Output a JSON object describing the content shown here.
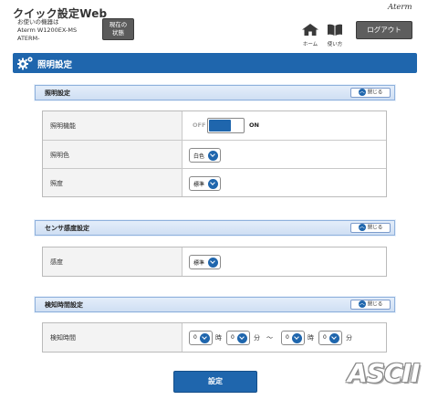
{
  "header": {
    "app_title": "クイック設定Web",
    "device_line1": "お使いの機器は",
    "device_line2": "Aterm W1200EX-MS",
    "device_line3": "ATERM-",
    "status_button_line1": "現在の",
    "status_button_line2": "状態",
    "brand": "Aterm",
    "home_label": "ホーム",
    "manual_label": "使い方",
    "logout_label": "ログアウト"
  },
  "page": {
    "title": "照明設定",
    "icon": "gear-icon"
  },
  "sections": [
    {
      "title": "照明設定",
      "close_label": "閉じる",
      "rows": [
        {
          "label": "照明機能",
          "toggle_off": "OFF",
          "toggle_on": "ON",
          "state": "ON"
        },
        {
          "label": "照明色",
          "value": "白色"
        },
        {
          "label": "照度",
          "value": "標準"
        }
      ]
    },
    {
      "title": "センサ感度設定",
      "close_label": "閉じる",
      "rows": [
        {
          "label": "感度",
          "value": "標準"
        }
      ]
    },
    {
      "title": "検知時間設定",
      "close_label": "閉じる",
      "rows": [
        {
          "label": "検知時間",
          "start_hour": "0",
          "hour_unit": "時",
          "start_min": "0",
          "min_unit": "分",
          "tilde": "～",
          "end_hour": "0",
          "end_hour_unit": "時",
          "end_min": "0",
          "end_min_unit": "分"
        }
      ]
    }
  ],
  "submit_label": "設定",
  "watermark": "ASCII",
  "colors": {
    "accent": "#1f66ad",
    "section_bg": "#d9e6f6",
    "dark_button": "#5e5e5e"
  }
}
